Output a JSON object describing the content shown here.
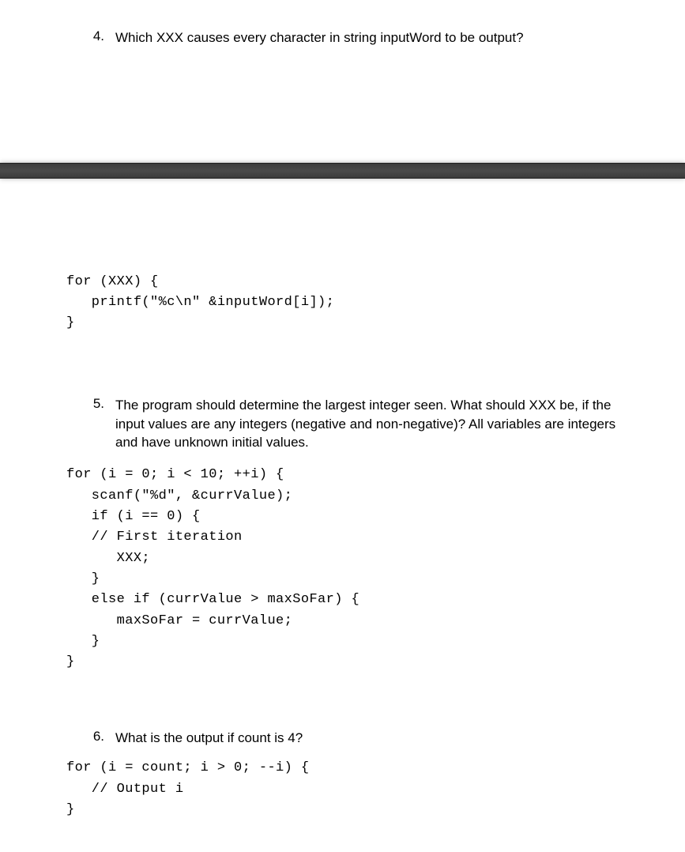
{
  "questions": {
    "q4": {
      "number": "4.",
      "text": "Which XXX causes every character in string inputWord to be output?",
      "code": "for (XXX) {\n   printf(\"%c\\n\" &inputWord[i]);\n}"
    },
    "q5": {
      "number": "5.",
      "text": "The program should determine the largest integer seen. What should XXX be, if the input values are any integers (negative and non-negative)? All variables are integers and have unknown initial values.",
      "code": "for (i = 0; i < 10; ++i) {\n   scanf(\"%d\", &currValue);\n   if (i == 0) {\n   // First iteration\n      XXX;\n   }\n   else if (currValue > maxSoFar) {\n      maxSoFar = currValue;\n   }\n}"
    },
    "q6": {
      "number": "6.",
      "text": "What is the output if count is 4?",
      "code": "for (i = count; i > 0; --i) {\n   // Output i\n}"
    }
  }
}
